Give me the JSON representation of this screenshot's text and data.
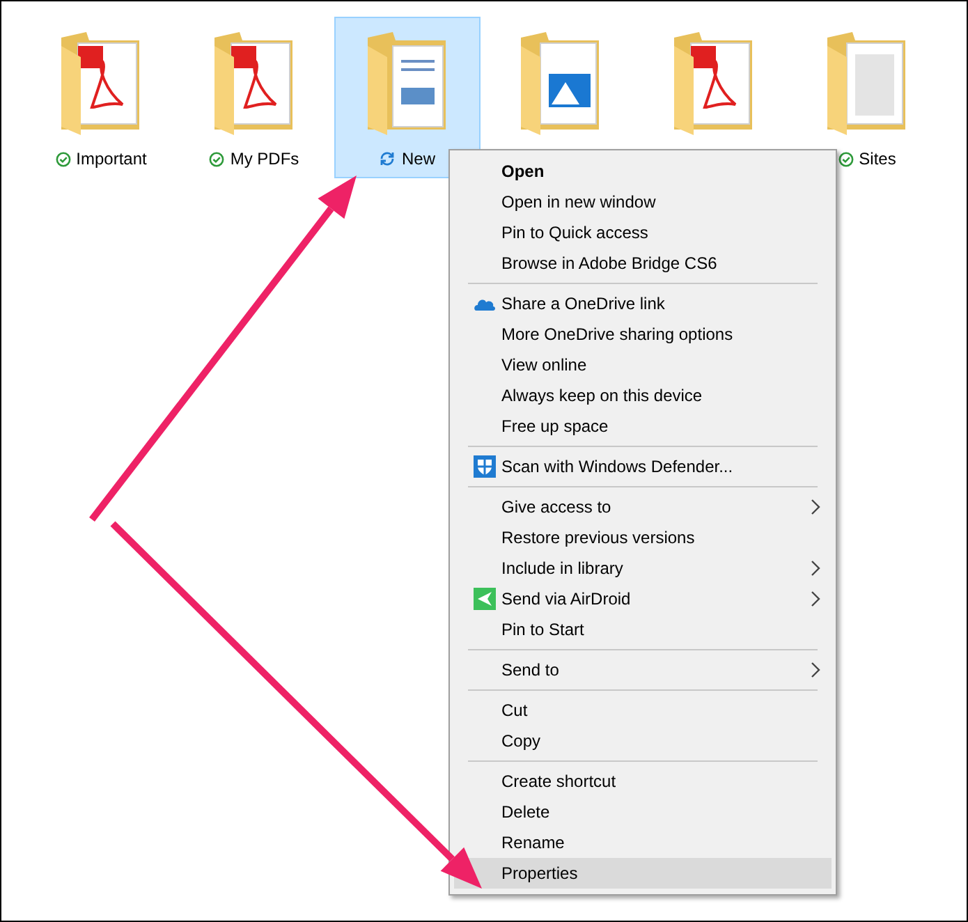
{
  "folders": [
    {
      "label": "Important",
      "kind": "pdf",
      "syncing": false,
      "selected": false
    },
    {
      "label": "My PDFs",
      "kind": "pdf",
      "syncing": false,
      "selected": false
    },
    {
      "label": "New",
      "kind": "doc",
      "syncing": true,
      "selected": true
    },
    {
      "kind": "image",
      "selected": false
    },
    {
      "kind": "pdf",
      "selected": false
    },
    {
      "label": "Sites",
      "kind": "text",
      "syncing": false,
      "selected": false
    }
  ],
  "context_menu": {
    "groups": [
      [
        {
          "label": "Open",
          "bold": true,
          "selected": false
        },
        {
          "label": "Open in new window",
          "selected": false
        },
        {
          "label": "Pin to Quick access",
          "selected": false
        },
        {
          "label": "Browse in Adobe Bridge CS6",
          "selected": false
        }
      ],
      [
        {
          "label": "Share a OneDrive link",
          "kind": "cloud",
          "selected": false
        },
        {
          "label": "More OneDrive sharing options",
          "selected": false
        },
        {
          "label": "View online",
          "selected": false
        },
        {
          "label": "Always keep on this device",
          "selected": false
        },
        {
          "label": "Free up space",
          "selected": false
        }
      ],
      [
        {
          "label": "Scan with Windows Defender...",
          "kind": "shield",
          "selected": false
        }
      ],
      [
        {
          "label": "Give access to",
          "submenu": true,
          "selected": false
        },
        {
          "label": "Restore previous versions",
          "selected": false
        },
        {
          "label": "Include in library",
          "submenu": true,
          "selected": false
        },
        {
          "label": "Send via AirDroid",
          "kind": "send",
          "submenu": true,
          "selected": false
        },
        {
          "label": "Pin to Start",
          "selected": false
        }
      ],
      [
        {
          "label": "Send to",
          "submenu": true,
          "selected": false
        }
      ],
      [
        {
          "label": "Cut",
          "selected": false
        },
        {
          "label": "Copy",
          "selected": false
        }
      ],
      [
        {
          "label": "Create shortcut",
          "selected": false
        },
        {
          "label": "Delete",
          "selected": false
        },
        {
          "label": "Rename",
          "selected": false
        },
        {
          "label": "Properties",
          "selected": true
        }
      ]
    ]
  }
}
